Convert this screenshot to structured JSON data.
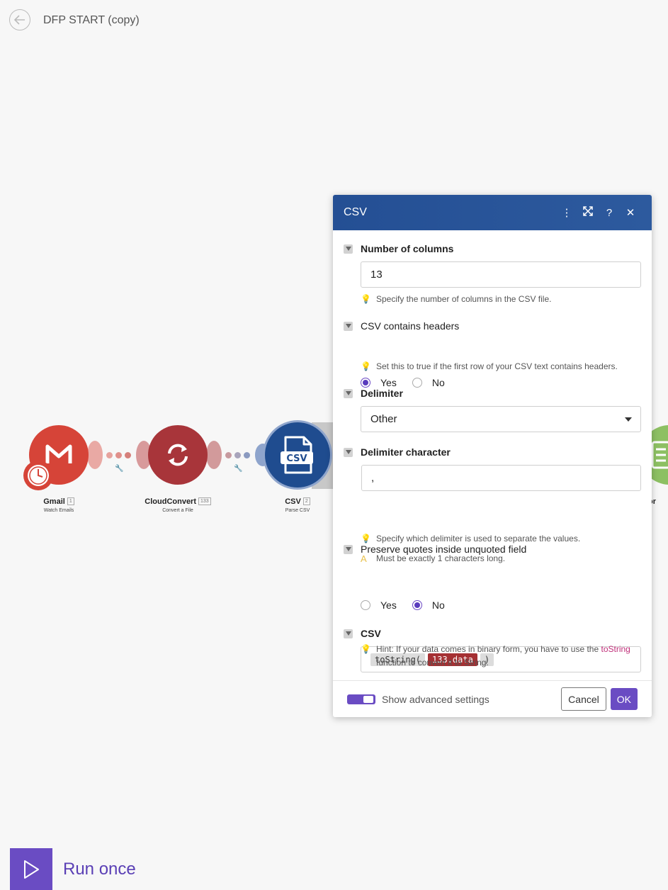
{
  "header": {
    "title": "DFP START (copy)"
  },
  "modules": [
    {
      "name": "Gmail",
      "badge": "1",
      "subtitle": "Watch Emails",
      "color": "#d64438"
    },
    {
      "name": "CloudConvert",
      "badge": "133",
      "subtitle": "Convert a File",
      "color": "#a8353a"
    },
    {
      "name": "CSV",
      "badge": "2",
      "subtitle": "Parse CSV",
      "color": "#1f4c8f"
    },
    {
      "name": "rator",
      "color": "#8dc063"
    }
  ],
  "dialog": {
    "title": "CSV",
    "fields": {
      "num_columns": {
        "label": "Number of columns",
        "value": "13",
        "hint": "Specify the number of columns in the CSV file."
      },
      "contains_headers": {
        "label": "CSV contains headers",
        "yes": "Yes",
        "no": "No",
        "selected": "Yes",
        "hint": "Set this to true if the first row of your CSV text contains headers."
      },
      "delimiter": {
        "label": "Delimiter",
        "value": "Other"
      },
      "delimiter_char": {
        "label": "Delimiter character",
        "value": ",",
        "hint": "Specify which delimiter is used to separate the values.",
        "warning": "Must be exactly 1 characters long."
      },
      "preserve_quotes": {
        "label": "Preserve quotes inside unquoted field",
        "yes": "Yes",
        "no": "No",
        "selected": "No"
      },
      "csv": {
        "label": "CSV",
        "pill_fn": "toString(",
        "pill_data": "133.data",
        "pill_close": ")",
        "hint_before": "Hint: If your data comes in binary form, you have to use the",
        "hint_fn": "toString",
        "hint_after": "function to convert it to String."
      }
    },
    "footer": {
      "advanced_label": "Show advanced settings",
      "advanced_on": true,
      "cancel": "Cancel",
      "ok": "OK"
    }
  },
  "run": {
    "label": "Run once"
  },
  "colors": {
    "accent": "#6a4cc3",
    "dialog_header": "#244f94"
  }
}
